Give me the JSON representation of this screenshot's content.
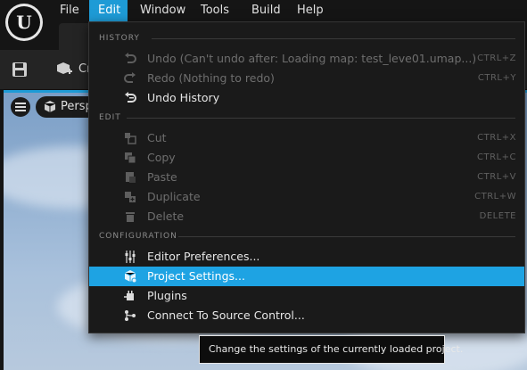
{
  "menubar": {
    "items": [
      {
        "label": "File",
        "active": false
      },
      {
        "label": "Edit",
        "active": true
      },
      {
        "label": "Window",
        "active": false
      },
      {
        "label": "Tools",
        "active": false
      },
      {
        "label": "Build",
        "active": false
      },
      {
        "label": "Help",
        "active": false
      }
    ]
  },
  "logo": {
    "glyph": "U"
  },
  "toolbar": {
    "create_label": "Cr"
  },
  "viewport": {
    "perspective_label": "Persp"
  },
  "edit_menu": {
    "sections": [
      {
        "title": "HISTORY",
        "items": [
          {
            "label": "Undo (Can't undo after: Loading map: test_leve01.umap...)",
            "shortcut": "CTRL+Z",
            "icon": "undo-icon",
            "enabled": false
          },
          {
            "label": "Redo (Nothing to redo)",
            "shortcut": "CTRL+Y",
            "icon": "redo-icon",
            "enabled": false
          },
          {
            "label": "Undo History",
            "shortcut": "",
            "icon": "undo-history-icon",
            "enabled": true
          }
        ]
      },
      {
        "title": "EDIT",
        "items": [
          {
            "label": "Cut",
            "shortcut": "CTRL+X",
            "icon": "cut-icon",
            "enabled": false
          },
          {
            "label": "Copy",
            "shortcut": "CTRL+C",
            "icon": "copy-icon",
            "enabled": false
          },
          {
            "label": "Paste",
            "shortcut": "CTRL+V",
            "icon": "paste-icon",
            "enabled": false
          },
          {
            "label": "Duplicate",
            "shortcut": "CTRL+W",
            "icon": "duplicate-icon",
            "enabled": false
          },
          {
            "label": "Delete",
            "shortcut": "DELETE",
            "icon": "trash-icon",
            "enabled": false
          }
        ]
      },
      {
        "title": "CONFIGURATION",
        "items": [
          {
            "label": "Editor Preferences...",
            "shortcut": "",
            "icon": "sliders-icon",
            "enabled": true
          },
          {
            "label": "Project Settings...",
            "shortcut": "",
            "icon": "project-settings-icon",
            "enabled": true,
            "highlighted": true
          },
          {
            "label": "Plugins",
            "shortcut": "",
            "icon": "plugin-icon",
            "enabled": true
          },
          {
            "label": "Connect To Source Control...",
            "shortcut": "",
            "icon": "source-control-icon",
            "enabled": true
          }
        ]
      }
    ]
  },
  "tooltip": {
    "text": "Change the settings of the currently loaded project."
  },
  "colors": {
    "accent": "#1ea3e3",
    "menu_bg": "#1a1a1a",
    "disabled_text": "#6e6e6e"
  }
}
